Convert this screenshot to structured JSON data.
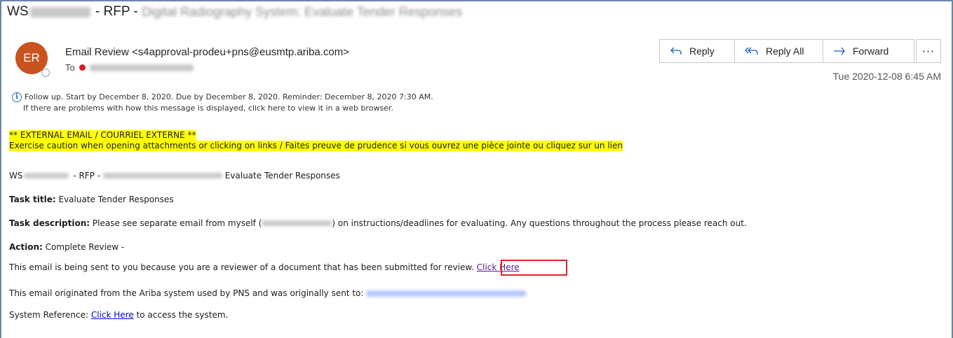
{
  "subject": {
    "prefix": "WS",
    "redacted_1": "xxxxxxxxxx",
    "middle": " - RFP - ",
    "redacted_2": "Digital Radiography System: Evaluate Tender Responses"
  },
  "sender": {
    "avatar_initials": "ER",
    "display": "Email Review <s4approval-prodeu+pns@eusmtp.ariba.com>",
    "to_label": "To",
    "to_redacted": "Johnson, Rennet"
  },
  "actions": {
    "reply": "Reply",
    "reply_all": "Reply All",
    "forward": "Forward",
    "more": "···"
  },
  "date": "Tue 2020-12-08 6:45 AM",
  "info": {
    "followup": "Follow up.  Start by December 8, 2020.  Due by December 8, 2020.  Reminder: December 8, 2020 7:30 AM.",
    "browser_note": "If there are problems with how this message is displayed, click here to view it in a web browser."
  },
  "body": {
    "warning_1": "** EXTERNAL EMAIL / COURRIEL EXTERNE **",
    "warning_2": "Exercise caution when opening attachments or clicking on links / Faites preuve de prudence si vous ouvrez une pièce jointe ou cliquez sur un lien",
    "ref_prefix": "WS",
    "ref_rfp": " - RFP - ",
    "ref_title": " Evaluate Tender Responses",
    "task_title_label": "Task title:",
    "task_title_value": " Evaluate Tender Responses",
    "task_desc_label": "Task description:",
    "task_desc_pre": " Please see separate email from myself (",
    "task_desc_post": ") on instructions/deadlines for evaluating. Any questions throughout the process please reach out.",
    "action_label": "Action:",
    "action_value": " Complete Review -",
    "reviewer_text": "This email is being sent to you because you are a reviewer of a document that has been submitted for review. ",
    "click_here": "Click Here",
    "origin_text": "This email originated from the Ariba system used by PNS and was originally sent to: ",
    "sysref_label": "System Reference: ",
    "sysref_link": "Click Here",
    "sysref_post": " to access the system."
  },
  "colors": {
    "avatar": "#c9521e",
    "highlight": "#ffff00",
    "link": "#0000ee",
    "visited_link": "#551a8b",
    "callout_box": "#e02424"
  }
}
